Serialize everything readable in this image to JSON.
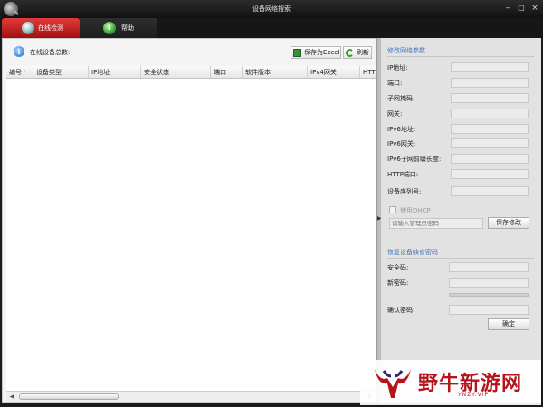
{
  "window": {
    "title": "设备网络搜索",
    "minimize": "–",
    "maximize": "□",
    "close": "×"
  },
  "tabs": [
    {
      "label": "在线检测",
      "icon": "magnifier-icon",
      "active": true
    },
    {
      "label": "帮助",
      "icon": "info-icon",
      "active": false
    }
  ],
  "toolbar": {
    "device_count_label": "在线设备总数:",
    "export_excel": "保存为Excel",
    "refresh": "刷新"
  },
  "grid": {
    "columns": [
      "编号",
      "设备类型",
      "IP地址",
      "安全状态",
      "端口",
      "软件版本",
      "IPv4网关",
      "HTT"
    ],
    "sort_indicator": "/",
    "rows": []
  },
  "modify": {
    "title": "修改网络参数",
    "fields": [
      {
        "label": "IP地址:",
        "value": ""
      },
      {
        "label": "端口:",
        "value": ""
      },
      {
        "label": "子网掩码:",
        "value": ""
      },
      {
        "label": "网关:",
        "value": ""
      },
      {
        "label": "IPv6地址:",
        "value": ""
      },
      {
        "label": "IPv6网关:",
        "value": ""
      },
      {
        "label": "IPv6子网前缀长度:",
        "value": ""
      },
      {
        "label": "HTTP端口:",
        "value": ""
      },
      {
        "label": "设备序列号:",
        "value": ""
      }
    ],
    "dhcp_label": "使用DHCP",
    "admin_password_placeholder": "请输入管理员密码",
    "save_button": "保存修改"
  },
  "restore": {
    "title": "恢复设备缺省密码",
    "security_code": "安全码:",
    "new_password": "新密码:",
    "confirm_password": "确认密码:",
    "confirm_button": "确定"
  },
  "watermark": {
    "text": "野牛新游网",
    "url": "YNZY.VIP"
  },
  "colors": {
    "active_tab": "#c81e1e",
    "section_title": "#4a79b5",
    "watermark": "#b4141c"
  }
}
